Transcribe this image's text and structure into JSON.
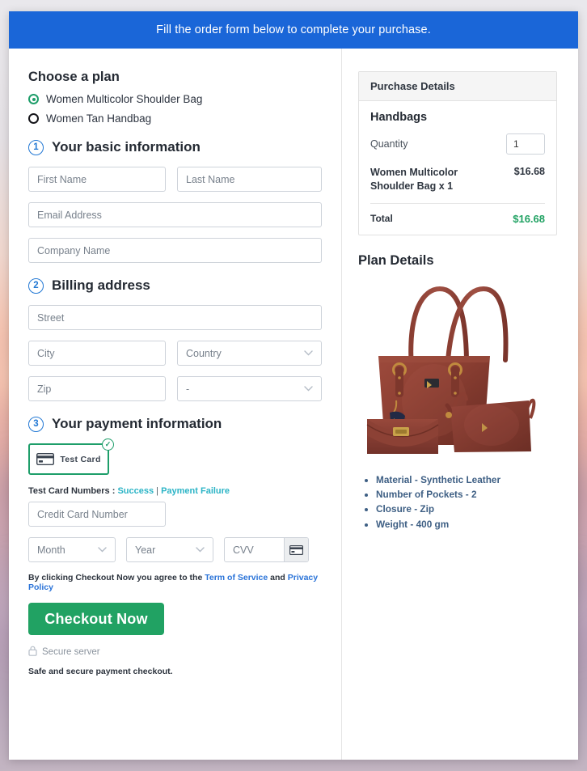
{
  "banner": {
    "text": "Fill the order form below to complete your purchase."
  },
  "plan": {
    "heading": "Choose a plan",
    "options": [
      {
        "label": "Women Multicolor Shoulder Bag",
        "selected": true
      },
      {
        "label": "Women Tan Handbag",
        "selected": false
      }
    ]
  },
  "steps": {
    "basic": {
      "number": "1",
      "title": "Your basic information"
    },
    "billing": {
      "number": "2",
      "title": "Billing address"
    },
    "payment": {
      "number": "3",
      "title": "Your payment information"
    }
  },
  "fields": {
    "first_name": "First Name",
    "last_name": "Last Name",
    "email": "Email Address",
    "company": "Company Name",
    "street": "Street",
    "city": "City",
    "country": "Country",
    "zip": "Zip",
    "state": "-",
    "credit_card": "Credit Card Number",
    "month": "Month",
    "year": "Year",
    "cvv": "CVV"
  },
  "payment": {
    "test_card_label": "Test Card",
    "test_numbers_prefix": "Test Card Numbers :",
    "success_link": "Success",
    "separator": "|",
    "failure_link": "Payment Failure"
  },
  "terms": {
    "prefix": "By clicking Checkout Now you agree to the",
    "tos": "Term of Service",
    "and": "and",
    "privacy": "Privacy Policy"
  },
  "checkout": {
    "button": "Checkout Now",
    "secure_server": "Secure server",
    "safe_text": "Safe and secure payment checkout."
  },
  "purchase": {
    "header": "Purchase Details",
    "category": "Handbags",
    "quantity_label": "Quantity",
    "quantity_value": "1",
    "item_name": "Women Multicolor Shoulder Bag x 1",
    "item_price": "$16.68",
    "total_label": "Total",
    "total_value": "$16.68"
  },
  "plan_details": {
    "title": "Plan Details",
    "features": [
      "Material - Synthetic Leather",
      "Number of Pockets - 2",
      "Closure - Zip",
      "Weight - 400 gm"
    ]
  },
  "colors": {
    "banner_blue": "#1a66d8",
    "green": "#21a263",
    "link_blue": "#2a73d8",
    "link_teal": "#2bb4c6",
    "step_blue": "#2278d4"
  }
}
